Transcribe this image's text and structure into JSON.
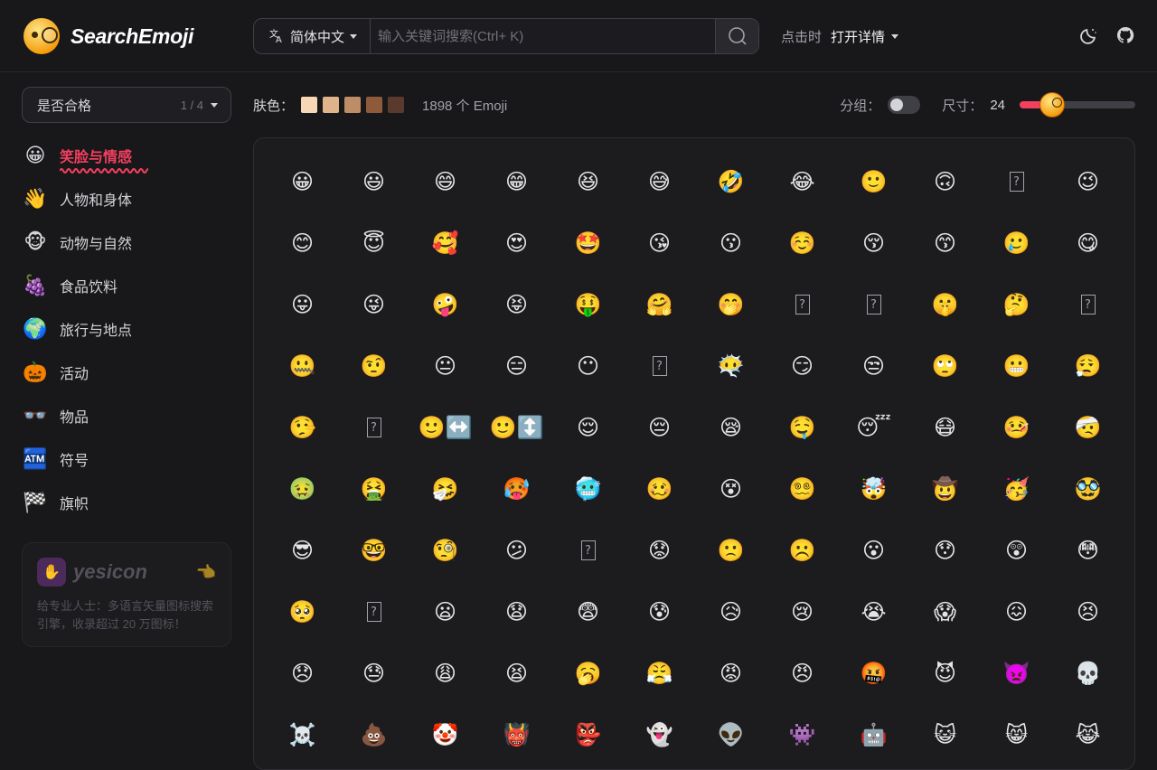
{
  "app": {
    "name": "SearchEmoji"
  },
  "header": {
    "language": "简体中文",
    "search_placeholder": "输入关键词搜索(Ctrl+ K)",
    "click_label": "点击时",
    "click_value": "打开详情"
  },
  "sidebar": {
    "filter": {
      "label": "是否合格",
      "count": "1 / 4"
    },
    "categories": [
      {
        "label": "笑脸与情感",
        "icon": "😀",
        "active": true
      },
      {
        "label": "人物和身体",
        "icon": "👋",
        "active": false
      },
      {
        "label": "动物与自然",
        "icon": "🐵",
        "active": false
      },
      {
        "label": "食品饮料",
        "icon": "🍇",
        "active": false
      },
      {
        "label": "旅行与地点",
        "icon": "🌍",
        "active": false
      },
      {
        "label": "活动",
        "icon": "🎃",
        "active": false
      },
      {
        "label": "物品",
        "icon": "👓",
        "active": false
      },
      {
        "label": "符号",
        "icon": "🏧",
        "active": false
      },
      {
        "label": "旗帜",
        "icon": "🏁",
        "active": false
      }
    ],
    "promo": {
      "name": "yesicon",
      "description": "给专业人士：多语言矢量图标搜索引擎，收录超过 20 万图标！"
    }
  },
  "toolbar": {
    "skin_label": "肤色：",
    "skin_tones": [
      "#f7d7b5",
      "#e0b48b",
      "#bf8d65",
      "#8f5a3a",
      "#5a3a2c"
    ],
    "count_text": "1898 个 Emoji",
    "group_label": "分组：",
    "group_enabled": false,
    "size_label": "尺寸：",
    "size_value": "24",
    "size_fraction": 0.28
  },
  "emojis": [
    "😀",
    "😃",
    "😄",
    "😁",
    "😆",
    "😅",
    "🤣",
    "😂",
    "🙂",
    "🙃",
    "?",
    "😉",
    "😊",
    "😇",
    "🥰",
    "😍",
    "🤩",
    "😘",
    "😗",
    "☺️",
    "😚",
    "😙",
    "🥲",
    "😋",
    "😛",
    "😜",
    "🤪",
    "😝",
    "🤑",
    "🤗",
    "🤭",
    "?",
    "?",
    "🤫",
    "🤔",
    "?",
    "🤐",
    "🤨",
    "😐",
    "😑",
    "😶",
    "?",
    "😶‍🌫️",
    "😏",
    "😒",
    "🙄",
    "😬",
    "😮‍💨",
    "🤥",
    "?",
    "🙂↔️",
    "🙂↕️",
    "😌",
    "😔",
    "😪",
    "🤤",
    "😴",
    "😷",
    "🤒",
    "🤕",
    "🤢",
    "🤮",
    "🤧",
    "🥵",
    "🥶",
    "🥴",
    "😵",
    "😵‍💫",
    "🤯",
    "🤠",
    "🥳",
    "🥸",
    "😎",
    "🤓",
    "🧐",
    "😕",
    "?",
    "😟",
    "🙁",
    "☹️",
    "😮",
    "😯",
    "😲",
    "😳",
    "🥺",
    "?",
    "😦",
    "😧",
    "😨",
    "😰",
    "😥",
    "😢",
    "😭",
    "😱",
    "😖",
    "😣",
    "😞",
    "😓",
    "😩",
    "😫",
    "🥱",
    "😤",
    "😡",
    "😠",
    "🤬",
    "😈",
    "👿",
    "💀",
    "☠️",
    "💩",
    "🤡",
    "👹",
    "👺",
    "👻",
    "👽",
    "👾",
    "🤖",
    "😺",
    "😸",
    "😹"
  ]
}
